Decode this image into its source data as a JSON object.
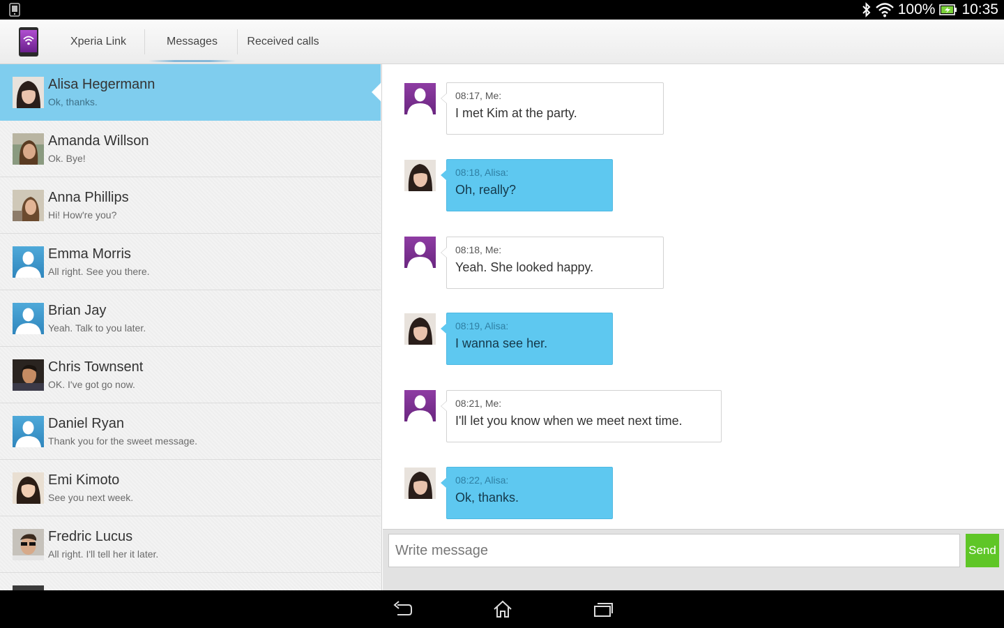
{
  "status_bar": {
    "battery": "100%",
    "time": "10:35"
  },
  "tabs": [
    {
      "label": "Xperia Link"
    },
    {
      "label": "Messages"
    },
    {
      "label": "Received calls"
    }
  ],
  "contacts": [
    {
      "name": "Alisa Hegermann",
      "last_message": "Ok, thanks.",
      "avatar": "photo"
    },
    {
      "name": "Amanda Willson",
      "last_message": "Ok. Bye!",
      "avatar": "photo"
    },
    {
      "name": "Anna Phillips",
      "last_message": "Hi!  How're you?",
      "avatar": "photo"
    },
    {
      "name": "Emma Morris",
      "last_message": "All right.  See you there.",
      "avatar": "person-placeholder-icon"
    },
    {
      "name": "Brian Jay",
      "last_message": "Yeah.  Talk to you later.",
      "avatar": "person-placeholder-icon"
    },
    {
      "name": "Chris Townsent",
      "last_message": "OK.  I've got go now.",
      "avatar": "photo"
    },
    {
      "name": "Daniel Ryan",
      "last_message": "Thank you for the sweet message.",
      "avatar": "person-placeholder-icon"
    },
    {
      "name": "Emi Kimoto",
      "last_message": "See you next week.",
      "avatar": "photo"
    },
    {
      "name": "Fredric Lucus",
      "last_message": "All right.  I'll tell her it later.",
      "avatar": "photo"
    }
  ],
  "messages": [
    {
      "meta": "08:17, Me:",
      "text": "I met Kim at the party.",
      "from": "me"
    },
    {
      "meta": "08:18, Alisa:",
      "text": "Oh, really?",
      "from": "them"
    },
    {
      "meta": "08:18, Me:",
      "text": "Yeah.  She looked happy.",
      "from": "me"
    },
    {
      "meta": "08:19, Alisa:",
      "text": "I wanna see her.",
      "from": "them"
    },
    {
      "meta": "08:21, Me:",
      "text": "I'll let you know when we meet next time.",
      "from": "me"
    },
    {
      "meta": "08:22, Alisa:",
      "text": "Ok, thanks.",
      "from": "them"
    }
  ],
  "compose": {
    "placeholder": "Write message",
    "send_label": "Send"
  },
  "colors": {
    "selected_contact": "#7fcdee",
    "incoming_bubble": "#5ec8f0",
    "send_button": "#5fc627",
    "me_avatar": "#7d2f8f"
  }
}
